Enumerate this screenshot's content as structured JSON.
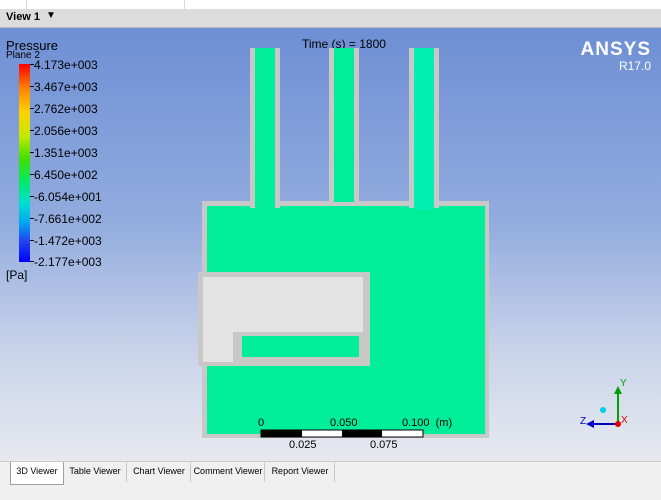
{
  "window": {
    "view_title": "View 1"
  },
  "legend": {
    "title": "Pressure",
    "subtitle": "Plane 2",
    "unit": "[Pa]",
    "labels": [
      "4.173e+003",
      "3.467e+003",
      "2.762e+003",
      "2.056e+003",
      "1.351e+003",
      "6.450e+002",
      "-6.054e+001",
      "-7.661e+002",
      "-1.472e+003",
      "-2.177e+003"
    ]
  },
  "time_label": "Time (s) = 1800",
  "logo": {
    "brand": "ANSYS",
    "version": "R17.0"
  },
  "scale": {
    "top_labels": [
      "0",
      "0.050",
      "0.100  (m)"
    ],
    "bottom_labels": [
      "0.025",
      "0.075"
    ]
  },
  "axes": {
    "y_label": "Y",
    "z_label": "Z",
    "x_label": "X"
  },
  "tabs": [
    "3D Viewer",
    "Table Viewer",
    "Chart Viewer",
    "Comment Viewer",
    "Report Viewer"
  ],
  "active_tab": "3D Viewer",
  "colors": {
    "fluid": "#00ee99",
    "wall": "#c8c8c8",
    "background_top": "#6e8fd5",
    "background_bottom": "#e7e9ef"
  }
}
